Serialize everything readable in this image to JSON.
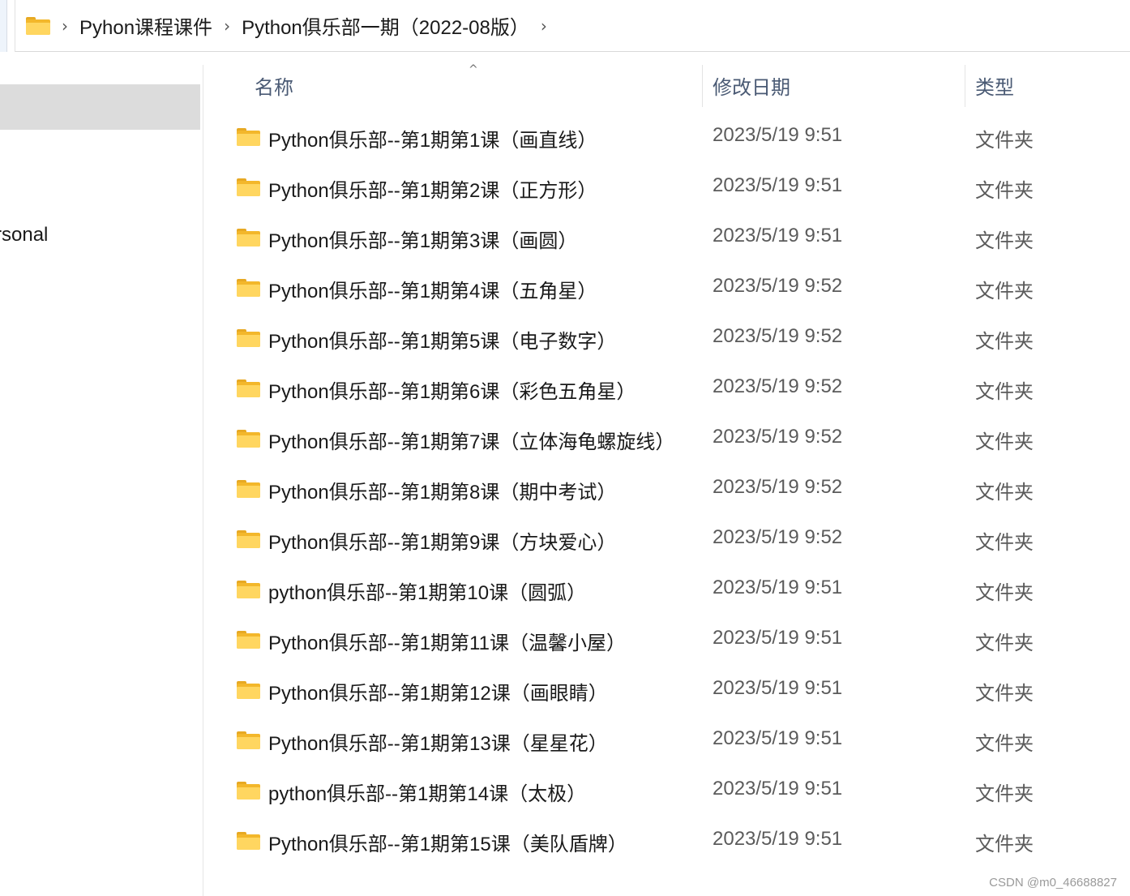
{
  "breadcrumb": {
    "items": [
      "Pyhon课程课件",
      "Python俱乐部一期（2022-08版）"
    ],
    "separator": "›"
  },
  "sidebar": {
    "partial_label": "rsonal"
  },
  "list": {
    "columns": {
      "name": "名称",
      "date": "修改日期",
      "type": "类型"
    },
    "sort_indicator": "^",
    "rows": [
      {
        "name": "Python俱乐部--第1期第1课（画直线）",
        "date": "2023/5/19 9:51",
        "type": "文件夹"
      },
      {
        "name": "Python俱乐部--第1期第2课（正方形）",
        "date": "2023/5/19 9:51",
        "type": "文件夹"
      },
      {
        "name": "Python俱乐部--第1期第3课（画圆）",
        "date": "2023/5/19 9:51",
        "type": "文件夹"
      },
      {
        "name": "Python俱乐部--第1期第4课（五角星）",
        "date": "2023/5/19 9:52",
        "type": "文件夹"
      },
      {
        "name": "Python俱乐部--第1期第5课（电子数字）",
        "date": "2023/5/19 9:52",
        "type": "文件夹"
      },
      {
        "name": "Python俱乐部--第1期第6课（彩色五角星）",
        "date": "2023/5/19 9:52",
        "type": "文件夹"
      },
      {
        "name": "Python俱乐部--第1期第7课（立体海龟螺旋线）",
        "date": "2023/5/19 9:52",
        "type": "文件夹"
      },
      {
        "name": "Python俱乐部--第1期第8课（期中考试）",
        "date": "2023/5/19 9:52",
        "type": "文件夹"
      },
      {
        "name": "Python俱乐部--第1期第9课（方块爱心）",
        "date": "2023/5/19 9:52",
        "type": "文件夹"
      },
      {
        "name": "python俱乐部--第1期第10课（圆弧）",
        "date": "2023/5/19 9:51",
        "type": "文件夹"
      },
      {
        "name": "Python俱乐部--第1期第11课（温馨小屋）",
        "date": "2023/5/19 9:51",
        "type": "文件夹"
      },
      {
        "name": "Python俱乐部--第1期第12课（画眼睛）",
        "date": "2023/5/19 9:51",
        "type": "文件夹"
      },
      {
        "name": "Python俱乐部--第1期第13课（星星花）",
        "date": "2023/5/19 9:51",
        "type": "文件夹"
      },
      {
        "name": "python俱乐部--第1期第14课（太极）",
        "date": "2023/5/19 9:51",
        "type": "文件夹"
      },
      {
        "name": "Python俱乐部--第1期第15课（美队盾牌）",
        "date": "2023/5/19 9:51",
        "type": "文件夹"
      }
    ]
  },
  "watermark": "CSDN @m0_46688827",
  "colors": {
    "folder_body": "#f3b72b",
    "folder_front": "#ffd660",
    "header_text": "#4a5a74",
    "selection": "#dcdcdc"
  }
}
